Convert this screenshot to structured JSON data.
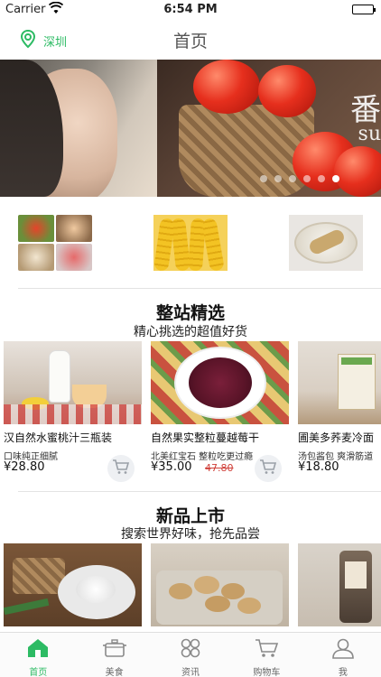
{
  "status_bar": {
    "carrier": "Carrier",
    "time": "6:54 PM"
  },
  "nav": {
    "city": "深圳",
    "title": "首页"
  },
  "banner": {
    "script_text": "番",
    "script_sub": "su",
    "slide_count": 6,
    "active_slide": 6
  },
  "section_featured": {
    "title": "整站精选",
    "subtitle": "精心挑选的超值好货"
  },
  "products": [
    {
      "name": "汉自然水蜜桃汁三瓶装",
      "desc": "口味纯正细腻",
      "price": "¥28.80",
      "old_price": ""
    },
    {
      "name": "自然果实整粒蔓越莓干",
      "desc": "北美红宝石 整粒吃更过瘾",
      "price": "¥35.00",
      "old_price": "47.80"
    },
    {
      "name": "圃美多荞麦冷面",
      "desc": "汤包酱包 爽滑筋道",
      "price": "¥18.80",
      "old_price": ""
    }
  ],
  "section_new": {
    "title": "新品上市",
    "subtitle": "搜索世界好味，抢先品尝"
  },
  "tabs": [
    {
      "label": "首页",
      "icon": "home-icon",
      "active": true
    },
    {
      "label": "美食",
      "icon": "pot-icon",
      "active": false
    },
    {
      "label": "资讯",
      "icon": "news-icon",
      "active": false
    },
    {
      "label": "购物车",
      "icon": "cart-icon",
      "active": false
    },
    {
      "label": "我",
      "icon": "user-icon",
      "active": false
    }
  ],
  "colors": {
    "accent": "#2dbb64",
    "old_price": "#d0403a"
  }
}
